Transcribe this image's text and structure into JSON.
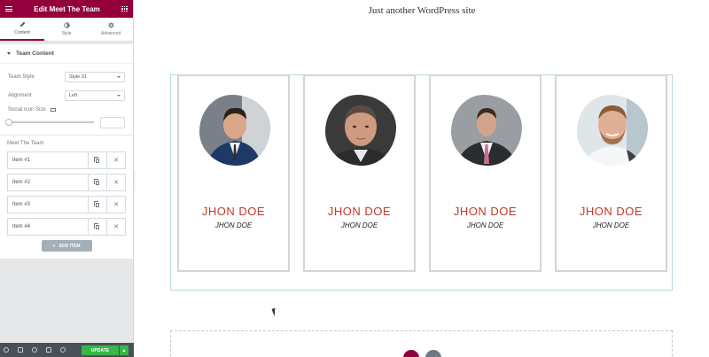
{
  "panel": {
    "title": "Edit Meet The Team",
    "tabs": [
      {
        "label": "Content",
        "active": true
      },
      {
        "label": "Style",
        "active": false
      },
      {
        "label": "Advanced",
        "active": false
      }
    ],
    "section_title": "Team Content",
    "team_style": {
      "label": "Team Style",
      "value": "Style 31"
    },
    "alignment": {
      "label": "Alignment",
      "value": "Left"
    },
    "social_icon_size": {
      "label": "Social Icon Size"
    },
    "repeater": {
      "label": "Meet The Team",
      "items": [
        "Item #1",
        "Item #2",
        "Item #3",
        "Item #4"
      ],
      "add_label": "ADD ITEM"
    },
    "footer": {
      "update_label": "UPDATE"
    },
    "accent_color": "#93003c"
  },
  "preview": {
    "site_title": "Just another WordPress site",
    "members": [
      {
        "name": "JHON DOE",
        "role": "JHON DOE"
      },
      {
        "name": "JHON DOE",
        "role": "JHON DOE"
      },
      {
        "name": "JHON DOE",
        "role": "JHON DOE"
      },
      {
        "name": "JHON DOE",
        "role": "JHON DOE"
      }
    ],
    "name_color": "#c0392b"
  }
}
